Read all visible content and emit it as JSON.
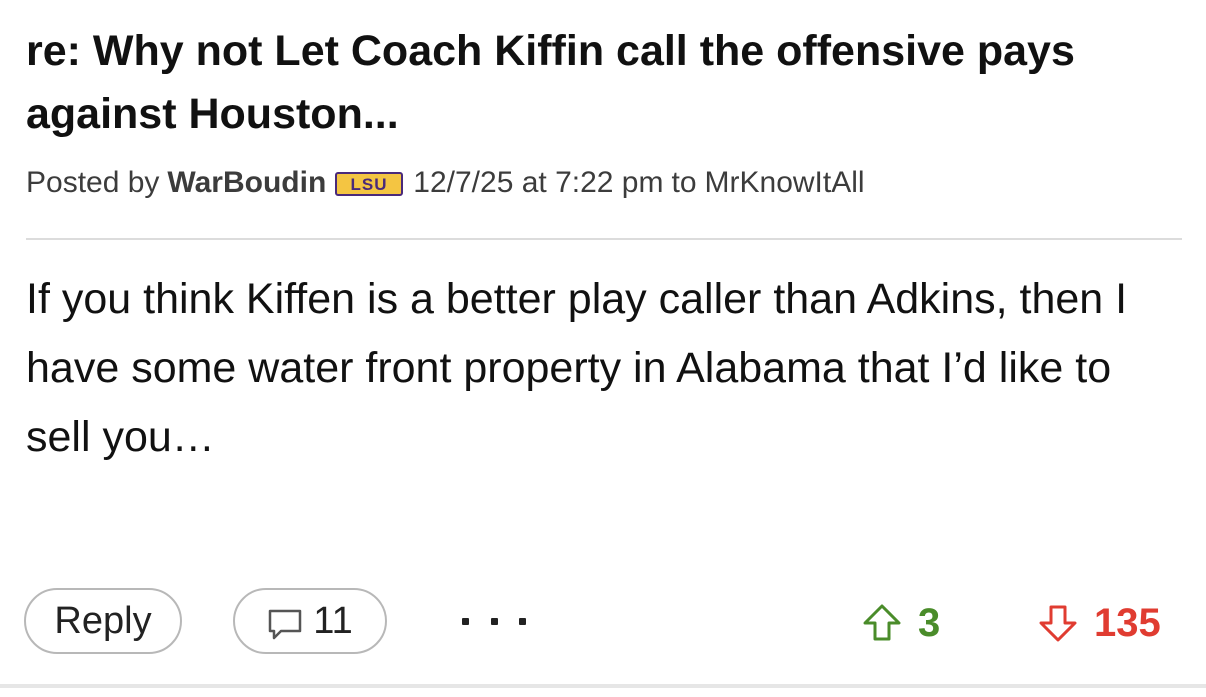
{
  "post": {
    "title": "re: Why not Let Coach Kiffin call the offensive pays against Houston...",
    "meta": {
      "posted_by_label": "Posted by",
      "author": "WarBoudin",
      "team_badge": "LSU",
      "team_badge_colors": {
        "fill": "#f4c542",
        "text": "#4a2a7a"
      },
      "date": "12/7/25 at 7:22 pm",
      "to_label": "to",
      "recipient": "MrKnowItAll"
    },
    "body": "If you think Kiffen is a better play caller than Adkins, then I have some water front property in Alabama that I’d like to sell you…"
  },
  "actions": {
    "reply_label": "Reply",
    "comment_icon": "speech-bubble-icon",
    "comment_count": "11",
    "more_icon": "ellipsis-icon",
    "upvote_icon": "arrow-up-icon",
    "upvote_count": "3",
    "upvote_color": "#4a8c2a",
    "downvote_icon": "arrow-down-icon",
    "downvote_count": "135",
    "downvote_color": "#e03c31"
  }
}
